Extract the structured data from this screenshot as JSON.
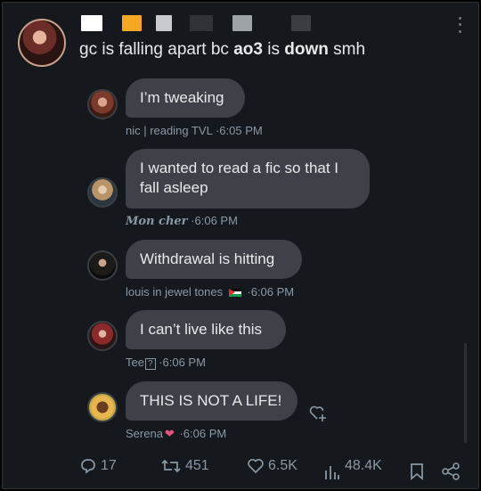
{
  "post": {
    "text_prefix": "gc is falling apart bc ",
    "text_bold1": "ao3",
    "text_mid": " is ",
    "text_bold2": "down",
    "text_suffix": " smh",
    "name_blocks": [
      "#ffffff",
      "#f5a623",
      "#c7cbd0",
      "#2f3338",
      "#9ea3a8",
      "#3a3e43"
    ]
  },
  "messages": [
    {
      "text": "I’m tweaking",
      "sender": "nic | reading TVL",
      "time": "6:05 PM",
      "avatar": "avatar-nic"
    },
    {
      "text": "I wanted to read a fic so that I fall asleep",
      "sender": "Mon cher",
      "time": "6:06 PM",
      "avatar": "avatar-mon-cher"
    },
    {
      "text": "Withdrawal is hitting",
      "sender": "louis in jewel tones",
      "time": "6:06 PM",
      "avatar": "avatar-louis"
    },
    {
      "text": "I can’t live like this",
      "sender": "Tee",
      "sender_glyph": "?",
      "time": "6:06 PM",
      "avatar": "avatar-tee"
    },
    {
      "text": "THIS IS NOT A LIFE!",
      "sender": "Serena",
      "time": "6:06 PM",
      "avatar": "avatar-serena"
    }
  ],
  "separator": "·",
  "actions": {
    "replies": "17",
    "reposts": "451",
    "likes": "6.5K",
    "views": "48.4K"
  },
  "icons": {
    "more": "more-vertical-icon",
    "reply": "comment-icon",
    "repost": "repost-icon",
    "like": "heart-icon",
    "views": "analytics-icon",
    "bookmark": "bookmark-icon",
    "share": "share-icon",
    "react": "add-reaction-icon"
  },
  "colors": {
    "background": "#15181c",
    "bubble": "#3e4248",
    "text": "#e7e9ea",
    "muted": "#8b98a5"
  }
}
